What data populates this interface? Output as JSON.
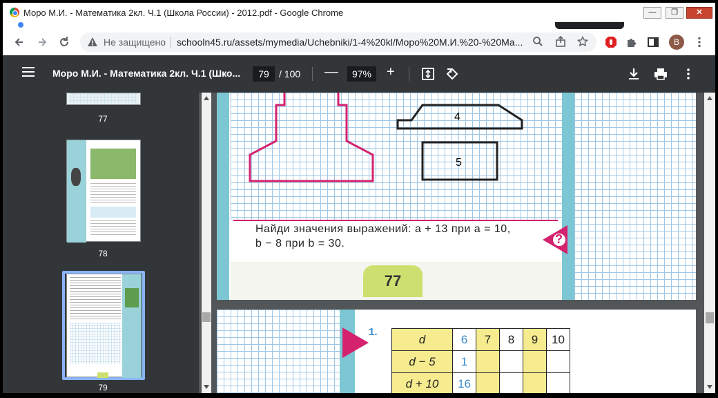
{
  "window": {
    "title": "Моро М.И. - Математика 2кл. Ч.1 (Школа России) - 2012.pdf - Google Chrome",
    "minimize": "—",
    "restore": "❐",
    "close": "✕"
  },
  "toolbar": {
    "security_label": "Не защищено",
    "url": "schooln45.ru/assets/mymedia/Uchebniki/1-4%20kl/Моро%20М.И.%20-%20Ма...",
    "avatar_letter": "В"
  },
  "pdf": {
    "title": "Моро М.И. - Математика 2кл. Ч.1 (Шко...",
    "current_page": "79",
    "total_pages": "/ 100",
    "zoom": "97%",
    "zoom_out": "—",
    "zoom_in": "+"
  },
  "thumbnails": [
    {
      "label": "77"
    },
    {
      "label": "78"
    },
    {
      "label": "79"
    }
  ],
  "page77": {
    "shape4_label": "4",
    "shape5_label": "5",
    "task_line1": "Найди значения выражений:  a + 13  при  a = 10,",
    "task_line2": "b − 8  при  b = 30.",
    "question_mark": "?",
    "page_number": "77"
  },
  "page78": {
    "exercise_number": "1.",
    "table": {
      "header": "d",
      "header_values": [
        "6",
        "7",
        "8",
        "9",
        "10"
      ],
      "rows": [
        {
          "label": "d − 5",
          "values": [
            "1",
            "",
            "",
            "",
            ""
          ]
        },
        {
          "label": "d + 10",
          "values": [
            "16",
            "",
            "",
            "",
            ""
          ]
        }
      ]
    }
  },
  "colors": {
    "pdf_toolbar": "#323639",
    "viewer_bg": "#525659",
    "grid_line": "#9fc7e6",
    "magenta": "#d4226e",
    "teal": "#7cc7d3",
    "page_tab": "#cde06f",
    "table_yellow": "#f6ec8f"
  }
}
